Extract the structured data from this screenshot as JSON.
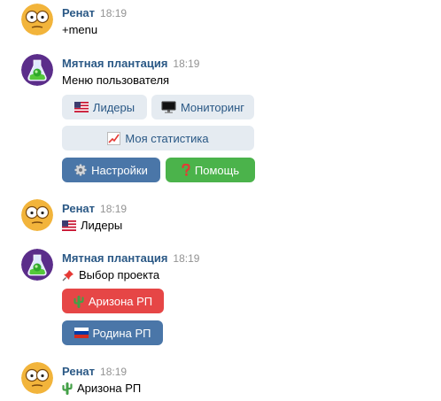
{
  "messages": [
    {
      "author": "Ренат",
      "time": "18:19",
      "text": "+menu"
    },
    {
      "author": "Мятная плантация",
      "time": "18:19",
      "text": "Меню пользователя",
      "buttons": {
        "leaders": "Лидеры",
        "monitoring": "Мониторинг",
        "stats": "Моя статистика",
        "settings": "Настройки",
        "help": "Помощь"
      }
    },
    {
      "author": "Ренат",
      "time": "18:19",
      "text": "Лидеры"
    },
    {
      "author": "Мятная плантация",
      "time": "18:19",
      "text": "Выбор проекта",
      "buttons": {
        "arizona": "Аризона РП",
        "rodina": "Родина РП"
      }
    },
    {
      "author": "Ренат",
      "time": "18:19",
      "text": "Аризона РП"
    }
  ],
  "icons": {
    "leaders": "us-flag-icon",
    "monitoring": "desktop-computer-icon",
    "stats": "chart-increasing-icon",
    "settings": "gear-icon",
    "help": "red-question-icon",
    "pin": "pushpin-icon",
    "arizona": "cactus-icon",
    "rodina": "russia-flag-icon"
  },
  "colors": {
    "name": "#2a5885",
    "time": "#939393",
    "btn_secondary": "#e5ebf1",
    "btn_primary": "#4a76a8",
    "btn_positive": "#4bb34b",
    "btn_negative": "#e64646"
  }
}
